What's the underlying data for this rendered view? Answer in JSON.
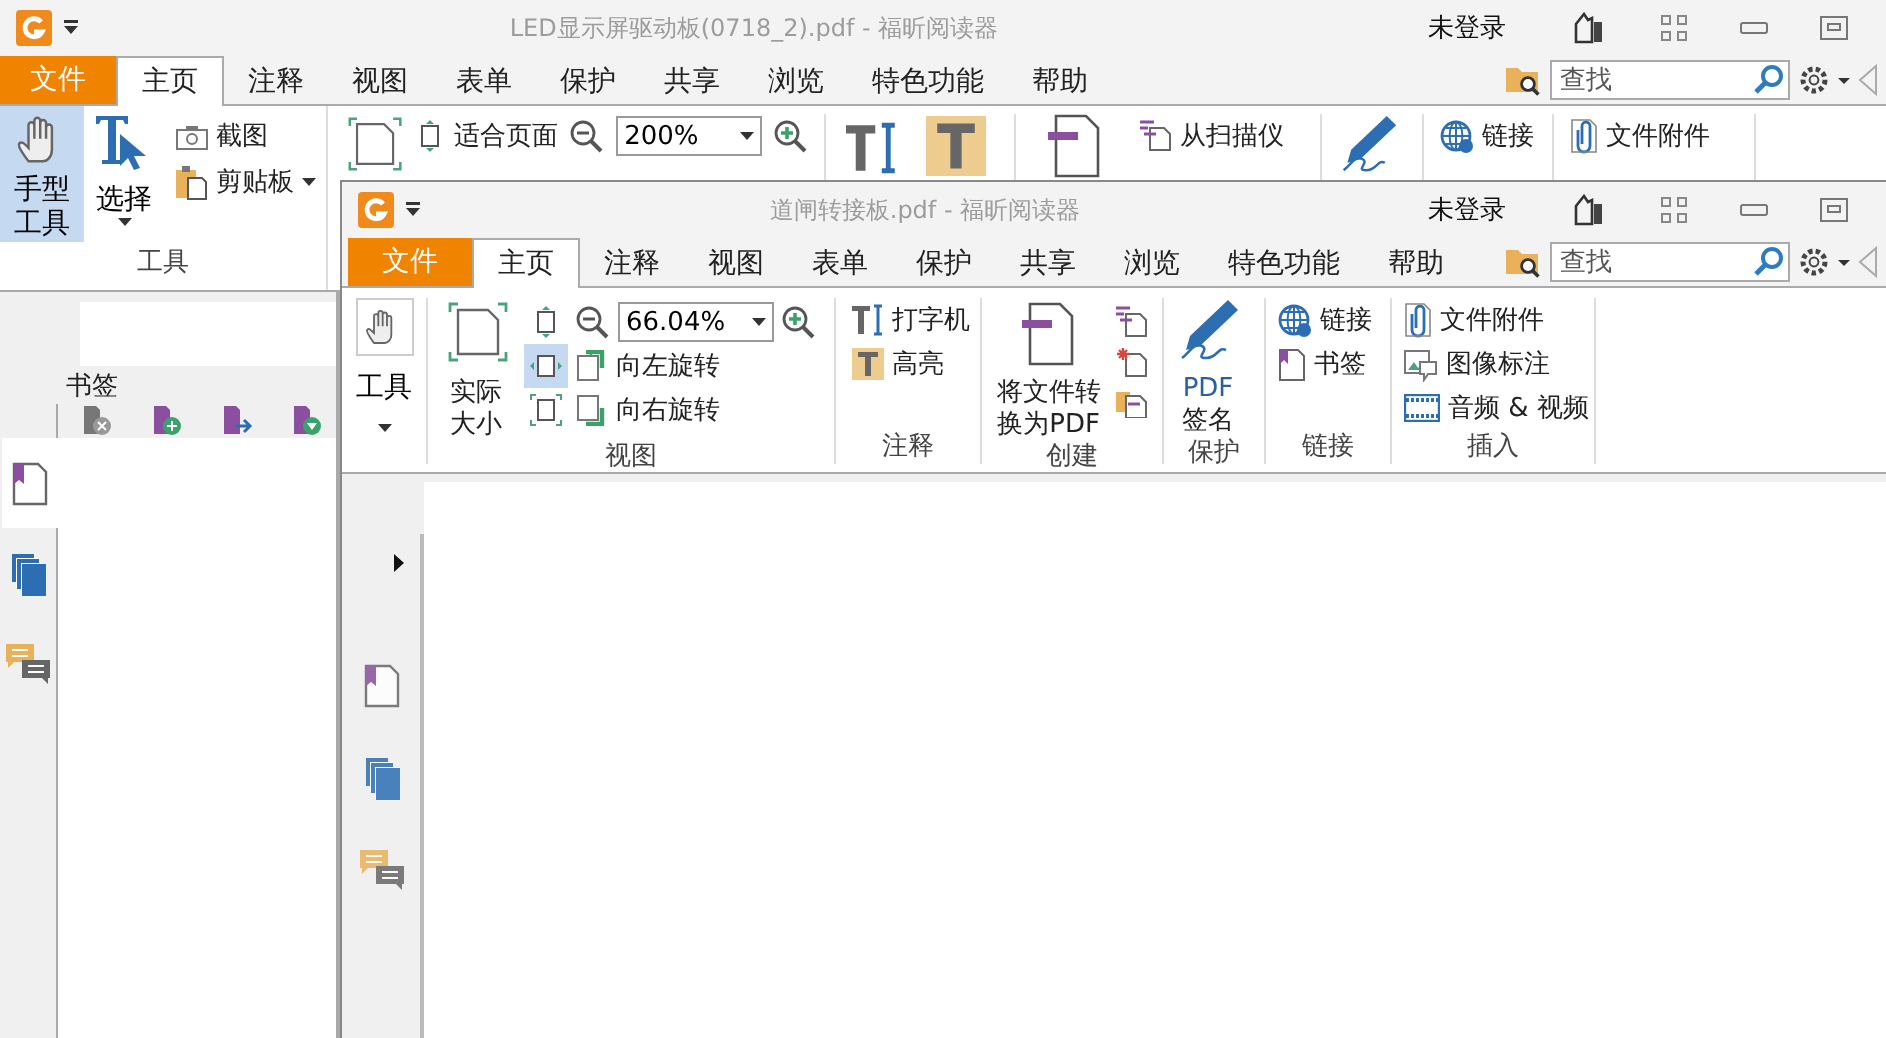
{
  "back_window": {
    "title": "LED显示屏驱动板(0718_2).pdf - 福昕阅读器",
    "account": "未登录",
    "file_menu": "文件",
    "tabs": [
      {
        "label": "主页",
        "selected": true
      },
      {
        "label": "注释",
        "selected": false
      },
      {
        "label": "视图",
        "selected": false
      },
      {
        "label": "表单",
        "selected": false
      },
      {
        "label": "保护",
        "selected": false
      },
      {
        "label": "共享",
        "selected": false
      },
      {
        "label": "浏览",
        "selected": false
      },
      {
        "label": "特色功能",
        "selected": false
      },
      {
        "label": "帮助",
        "selected": false
      }
    ],
    "search": {
      "placeholder": "查找"
    },
    "ribbon": {
      "hand_tool": {
        "label": "手型工具",
        "selected": true
      },
      "select_tool": "选择",
      "snapshot": "截图",
      "clipboard": "剪贴板",
      "group_label": "工具",
      "fit_page": "适合页面",
      "zoom": "200%",
      "scan": "从扫描仪",
      "link": "链接",
      "attachment": "文件附件"
    },
    "side_panel": {
      "title": "书签",
      "nav": [
        {
          "kind": "bookmarks",
          "selected": true
        },
        {
          "kind": "pages",
          "selected": false
        },
        {
          "kind": "comments",
          "selected": false
        }
      ]
    }
  },
  "front_window": {
    "title": "道闸转接板.pdf - 福昕阅读器",
    "account": "未登录",
    "file_menu": "文件",
    "tabs": [
      {
        "label": "主页",
        "selected": true
      },
      {
        "label": "注释",
        "selected": false
      },
      {
        "label": "视图",
        "selected": false
      },
      {
        "label": "表单",
        "selected": false
      },
      {
        "label": "保护",
        "selected": false
      },
      {
        "label": "共享",
        "selected": false
      },
      {
        "label": "浏览",
        "selected": false
      },
      {
        "label": "特色功能",
        "selected": false
      },
      {
        "label": "帮助",
        "selected": false
      }
    ],
    "search": {
      "placeholder": "查找"
    },
    "ribbon": {
      "tools": {
        "label": "工具",
        "selected": false
      },
      "view": {
        "label": "视图",
        "actual_size": "实际大小",
        "zoom": "66.04%",
        "rotate_left": "向左旋转",
        "rotate_right": "向右旋转",
        "fit_buttons": [
          {
            "kind": "fit-page",
            "selected": false
          },
          {
            "kind": "fit-width",
            "selected": true
          },
          {
            "kind": "fit-visible",
            "selected": false
          }
        ]
      },
      "comment": {
        "label": "注释",
        "typewriter": "打字机",
        "highlight": "高亮"
      },
      "create": {
        "label": "创建",
        "convert": "将文件转换为PDF"
      },
      "protect": {
        "label": "保护",
        "sign": [
          "PDF",
          "签名"
        ]
      },
      "links": {
        "label": "链接",
        "link": "链接",
        "bookmark": "书签"
      },
      "insert": {
        "label": "插入",
        "attachment": "文件附件",
        "image": "图像标注",
        "media": "音频 & 视频"
      }
    },
    "side_nav": [
      {
        "kind": "bookmarks",
        "selected": false
      },
      {
        "kind": "pages",
        "selected": false
      },
      {
        "kind": "comments",
        "selected": false
      }
    ]
  }
}
